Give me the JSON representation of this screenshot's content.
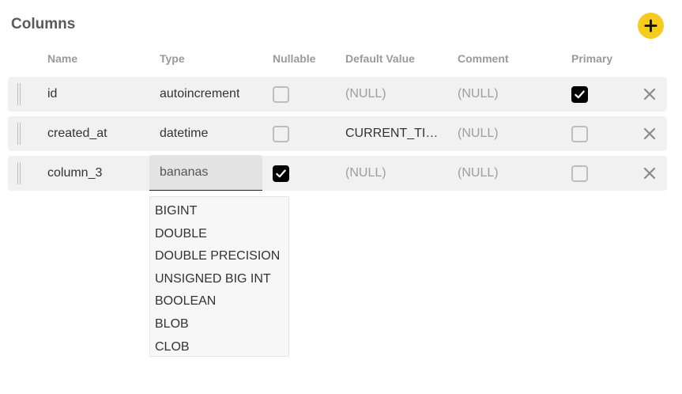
{
  "header": {
    "title": "Columns",
    "add_icon": "plus-icon",
    "accent": "#f5cc1e"
  },
  "columns": [
    "Name",
    "Type",
    "Nullable",
    "Default Value",
    "Comment",
    "Primary"
  ],
  "rows": [
    {
      "name": "id",
      "type": "autoincrement",
      "nullable": false,
      "default": "(NULL)",
      "comment": "(NULL)",
      "primary": true
    },
    {
      "name": "created_at",
      "type": "datetime",
      "nullable": false,
      "default": "CURRENT_TIMESTAMP",
      "comment": "(NULL)",
      "primary": false
    },
    {
      "name": "column_3",
      "type": "bananas",
      "nullable": true,
      "default": "(NULL)",
      "comment": "(NULL)",
      "primary": false
    }
  ],
  "type_options": [
    "BIGINT",
    "DOUBLE",
    "DOUBLE PRECISION",
    "UNSIGNED BIG INT",
    "BOOLEAN",
    "BLOB",
    "CLOB"
  ]
}
